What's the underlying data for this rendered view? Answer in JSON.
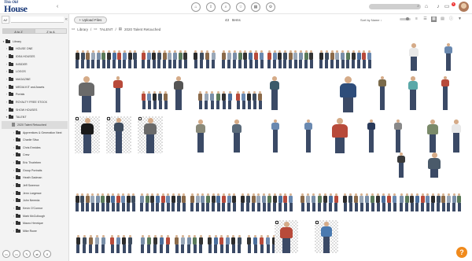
{
  "app": {
    "logo_small": "This Old",
    "logo_big": "House",
    "notification_count": "5"
  },
  "toolbar": {
    "upload_label": "+ Upload Files",
    "items_count": "43",
    "items_label": "Items",
    "sort_label": "Sort by Name ↓"
  },
  "sidebar": {
    "sort_az": "A to Z",
    "sort_za": "Z to A",
    "az_icon": "AZ",
    "items": [
      {
        "label": "Library",
        "level": 0,
        "expanded": true
      },
      {
        "label": "HOUSE ONE",
        "level": 1
      },
      {
        "label": "IDEA HOUSES",
        "level": 1
      },
      {
        "label": "INSIDER",
        "level": 1
      },
      {
        "label": "LOGOS",
        "level": 1
      },
      {
        "label": "MAGAZINE",
        "level": 1
      },
      {
        "label": "MEDIA KIT and Assets",
        "level": 1
      },
      {
        "label": "Portals",
        "level": 1
      },
      {
        "label": "ROYALTY FREE STOCK",
        "level": 1
      },
      {
        "label": "SHOW HOUSES",
        "level": 1
      },
      {
        "label": "TALENT",
        "level": 1,
        "expanded": true
      },
      {
        "label": "2020 Talent Retouched",
        "level": 2,
        "selected": true
      },
      {
        "label": "Apprentices & Generation Next",
        "level": 2
      },
      {
        "label": "Charlie Silva",
        "level": 2
      },
      {
        "label": "Chris Ermides",
        "level": 2
      },
      {
        "label": "Crew",
        "level": 2
      },
      {
        "label": "Eric Thorleben",
        "level": 2
      },
      {
        "label": "Group Portraits",
        "level": 2
      },
      {
        "label": "Heath Gadman",
        "level": 2
      },
      {
        "label": "Jeff Sweenor",
        "level": 2
      },
      {
        "label": "Jenn Largesse",
        "level": 2
      },
      {
        "label": "John Neeeda",
        "level": 2
      },
      {
        "label": "Kevin O'Connor",
        "level": 2
      },
      {
        "label": "Mark McCullough",
        "level": 2
      },
      {
        "label": "Mauro Henrique",
        "level": 2
      },
      {
        "label": "Mike Rowe",
        "level": 2
      }
    ]
  },
  "breadcrumb": {
    "library": "Library",
    "talent": "TALENT",
    "current": "2020 Talent Retouched",
    "sep": "/"
  },
  "icons": {
    "help": "?"
  }
}
